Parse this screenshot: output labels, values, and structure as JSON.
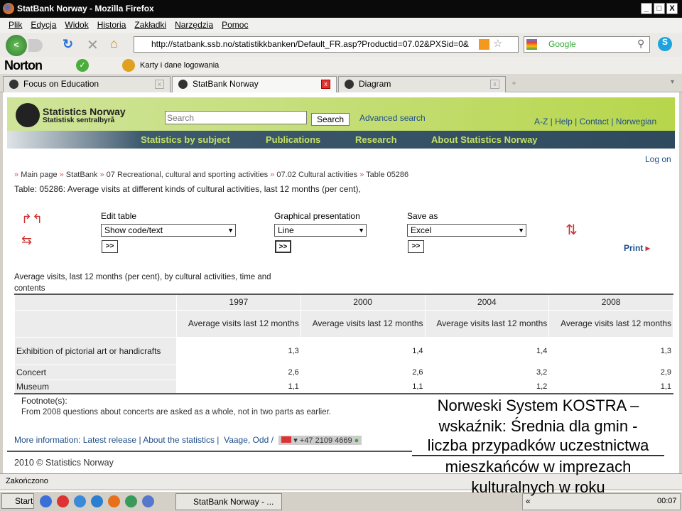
{
  "window": {
    "title": "StatBank Norway - Mozilla Firefox"
  },
  "menu": [
    "Plik",
    "Edycja",
    "Widok",
    "Historia",
    "Zakładki",
    "Narzędzia",
    "Pomoc"
  ],
  "navbar": {
    "url": "http://statbank.ssb.no/statistikkbanken/Default_FR.asp?Productid=07.02&PXSid=0&",
    "search_engine": "Google"
  },
  "norton": {
    "brand": "Norton",
    "passwords": "Karty i dane logowania"
  },
  "tabs": [
    {
      "label": "Focus on Education"
    },
    {
      "label": "StatBank Norway",
      "active": true
    },
    {
      "label": "Diagram"
    }
  ],
  "site": {
    "logo_line1": "Statistics Norway",
    "logo_line2": "Statistisk sentralbyrå",
    "search_placeholder": "Search",
    "search_button": "Search",
    "advanced_search": "Advanced search",
    "top_links": [
      "A-Z",
      "Help",
      "Contact",
      "Norwegian"
    ],
    "nav": [
      "Statistics by subject",
      "Publications",
      "Research",
      "About Statistics Norway"
    ],
    "log_on": "Log on",
    "breadcrumb": [
      "Main page",
      "StatBank",
      "07 Recreational, cultural and sporting activities",
      "07.02 Cultural activities",
      "Table 05286"
    ],
    "table_title": "Table: 05286: Average visits at different kinds of cultural activities, last 12 months (per cent),"
  },
  "controls": {
    "edit_table": {
      "label": "Edit table",
      "value": "Show code/text"
    },
    "graph": {
      "label": "Graphical presentation",
      "value": "Line"
    },
    "save": {
      "label": "Save as",
      "value": "Excel"
    },
    "go": ">>",
    "print": "Print"
  },
  "data_table": {
    "caption": "Average visits, last 12 months (per cent), by cultural activities, time and contents",
    "years": [
      "1997",
      "2000",
      "2004",
      "2008"
    ],
    "subheader": "Average visits last 12 months",
    "rows": [
      {
        "label": "Exhibition of pictorial art or handicrafts",
        "values": [
          "1,3",
          "1,4",
          "1,4",
          "1,3"
        ]
      },
      {
        "label": "Concert",
        "values": [
          "2,6",
          "2,6",
          "3,2",
          "2,9"
        ]
      },
      {
        "label": "Museum",
        "values": [
          "1,1",
          "1,1",
          "1,2",
          "1,1"
        ]
      }
    ]
  },
  "footnote": {
    "title": "Footnote(s):",
    "text": "From 2008 questions about concerts are asked as a whole, not in two parts as earlier."
  },
  "more_info": {
    "label": "More information:",
    "latest": "Latest release",
    "about": "About the statistics",
    "contact": "Vaage, Odd /",
    "phone": "+47 2109 4669"
  },
  "copyright": "2010 © Statistics Norway",
  "overlay": {
    "line1": "Norweski System KOSTRA –",
    "line2": "wskaźnik: Średnia dla gmin -",
    "line3": "liczba przypadków uczestnictwa",
    "line4": "mieszkańców w imprezach",
    "line5": "kulturalnych w roku"
  },
  "status": "Zakończono",
  "taskbar": {
    "start": "Start",
    "task": "StatBank Norway - ...",
    "clock": "00:07"
  }
}
